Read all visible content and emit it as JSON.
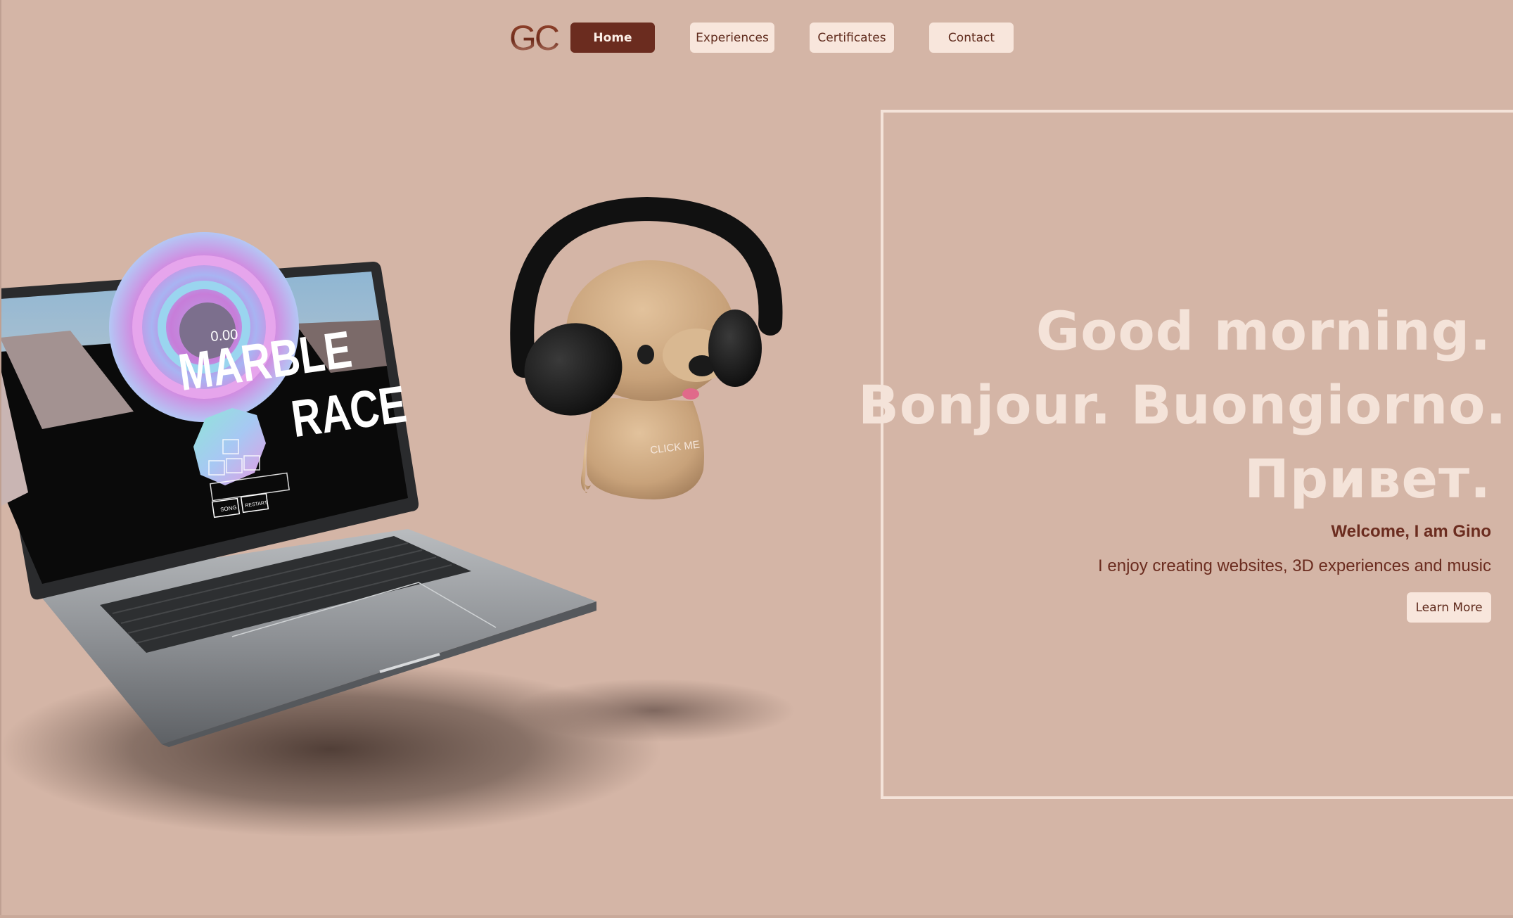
{
  "nav": {
    "logo": "GC",
    "items": [
      {
        "id": "home",
        "label": "Home",
        "active": true
      },
      {
        "id": "experiences",
        "label": "Experiences"
      },
      {
        "id": "certificates",
        "label": "Certificates"
      },
      {
        "id": "contact",
        "label": "Contact"
      }
    ]
  },
  "hero": {
    "greeting_lines": [
      "Good morning.",
      "Bonjour. Buongiorno.",
      "Привет."
    ],
    "welcome": "Welcome, I am Gino",
    "tagline": "I enjoy creating websites, 3D experiences and music",
    "learn_more_label": "Learn More"
  },
  "laptop_screen": {
    "timer": "0.00",
    "title_line1": "MARBLE",
    "title_line2": "RACE",
    "btn_left": "SONG",
    "btn_right": "RESTART"
  },
  "mascot": {
    "label": "CLICK ME"
  },
  "colors": {
    "background": "#d4b5a6",
    "accent_dark": "#6b2c1f",
    "light": "#f4e3d9",
    "button_bg": "#f8e6dc"
  }
}
